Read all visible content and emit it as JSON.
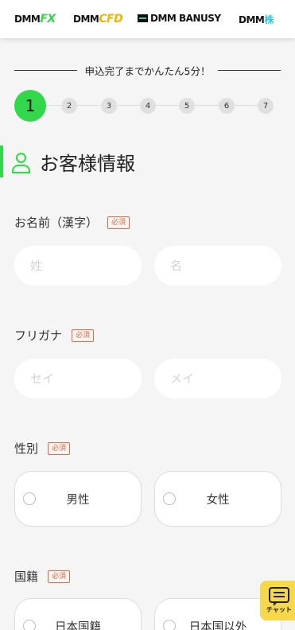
{
  "header": {
    "logos": [
      {
        "base": "DMM",
        "accent": "FX",
        "accent_color": "#32d74b"
      },
      {
        "base": "DMM",
        "accent": "CFD",
        "accent_color": "#f5b400"
      },
      {
        "base": "DMM BANUSY",
        "accent": "",
        "accent_color": "#3ccfa0"
      },
      {
        "base": "DMM",
        "accent": "株",
        "accent_color": "#2ec4ea"
      }
    ]
  },
  "intro": {
    "text": "申込完了までかんたん5分！"
  },
  "steps": {
    "current": "1",
    "others": [
      "2",
      "3",
      "4",
      "5",
      "6",
      "7"
    ]
  },
  "section": {
    "title": "お客様情報"
  },
  "form": {
    "required_badge": "必須",
    "name_kanji": {
      "label": "お名前（漢字）",
      "last_placeholder": "姓",
      "first_placeholder": "名"
    },
    "name_kana": {
      "label": "フリガナ",
      "last_placeholder": "セイ",
      "first_placeholder": "メイ"
    },
    "gender": {
      "label": "性別",
      "options": [
        "男性",
        "女性"
      ]
    },
    "nationality": {
      "label": "国籍",
      "options": [
        "日本国籍",
        "日本国以外"
      ]
    }
  },
  "chat": {
    "label": "チャット"
  },
  "colors": {
    "accent": "#32d74b",
    "required": "#e36a3d",
    "chat_bg": "#f6d84a"
  }
}
